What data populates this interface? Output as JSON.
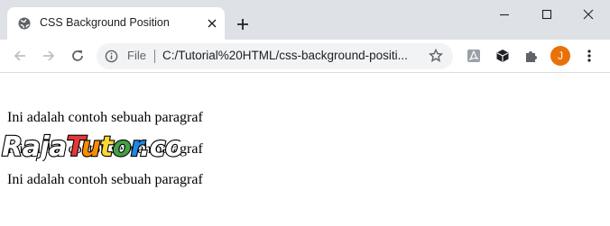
{
  "tab": {
    "title": "CSS Background Position",
    "favicon": "globe-icon",
    "close_icon": "close-icon"
  },
  "newtab": {
    "icon": "plus-icon"
  },
  "window_controls": [
    "minimize-icon",
    "maximize-icon",
    "close-icon"
  ],
  "toolbar": {
    "back_icon": "back-arrow-icon",
    "forward_icon": "forward-arrow-icon",
    "reload_icon": "reload-icon",
    "info_icon": "info-icon",
    "file_label": "File",
    "url": "C:/Tutorial%20HTML/css-background-positi...",
    "star_icon": "star-icon",
    "extensions": [
      "pdf-extension-icon",
      "cube-extension-icon",
      "puzzle-icon"
    ],
    "profile_initial": "J",
    "profile_color": "#e8710a",
    "menu_icon": "kebab-menu-icon"
  },
  "page": {
    "paragraphs": [
      "Ini adalah contoh sebuah paragraf",
      "Ini adalah contoh sebuah paragraf",
      "Ini adalah contoh sebuah paragraf"
    ],
    "watermark": "RajaTutor.com"
  },
  "colors": {
    "tabstrip_bg": "#dee1e6",
    "omnibox_bg": "#f1f3f4",
    "text": "#202124"
  }
}
